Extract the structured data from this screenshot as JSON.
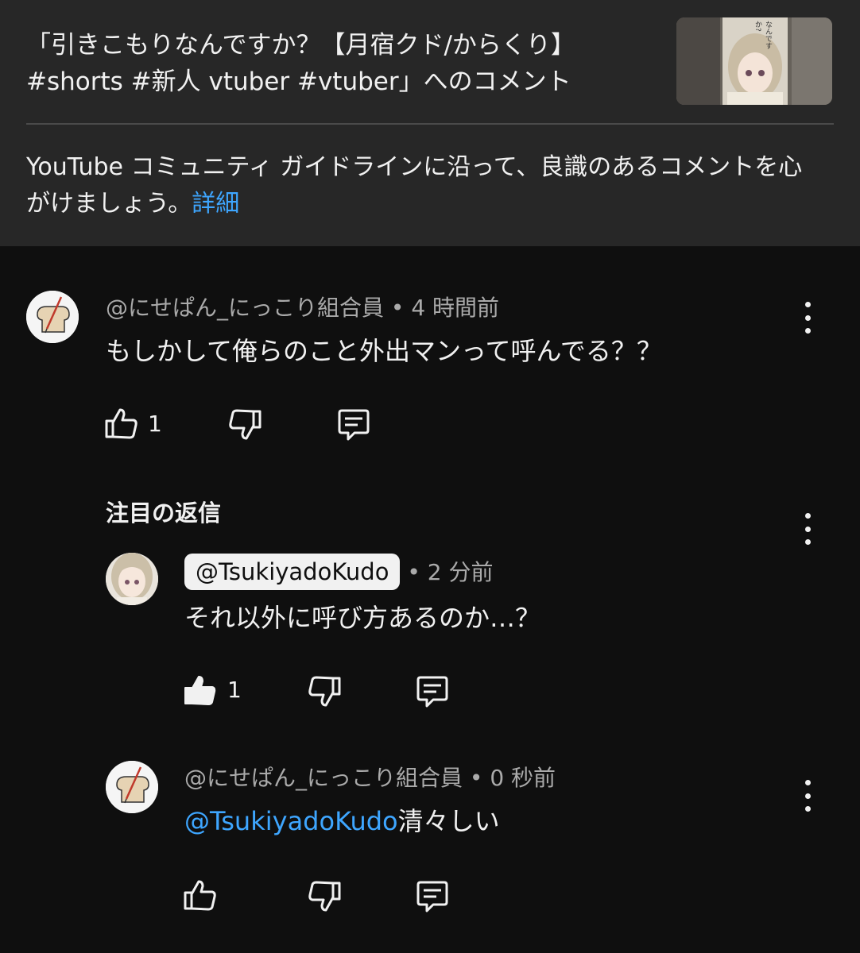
{
  "header": {
    "title": "「引きこもりなんですか？【月宿クド/からくり】#shorts #新人 vtuber #vtuber」へのコメント",
    "thumbnail_text": "なんですか?",
    "guideline_text": "YouTube コミュニティ ガイドラインに沿って、良識のあるコメントを心がけましょう。",
    "guideline_link": "詳細"
  },
  "comments": [
    {
      "author": "@にせぱん_にっこり組合員",
      "time": "4 時間前",
      "text": "もしかして俺らのこと外出マンって呼んでる？？",
      "likes": "1",
      "avatar_icon": "bread-avatar-icon"
    }
  ],
  "replies_section": {
    "label": "注目の返信"
  },
  "replies": [
    {
      "author": "@TsukiyadoKudo",
      "time": "2 分前",
      "text": "それ以外に呼び方あるのか…？",
      "likes": "1",
      "is_creator": true,
      "avatar_icon": "vtuber-avatar-icon"
    },
    {
      "author": "@にせぱん_にっこり組合員",
      "time": "0 秒前",
      "mention": "@TsukiyadoKudo",
      "text": "清々しい",
      "avatar_icon": "bread-avatar-icon"
    }
  ],
  "colors": {
    "background": "#0f0f0f",
    "header_bg": "#272727",
    "link": "#3ea6ff",
    "meta": "#aaaaaa"
  }
}
